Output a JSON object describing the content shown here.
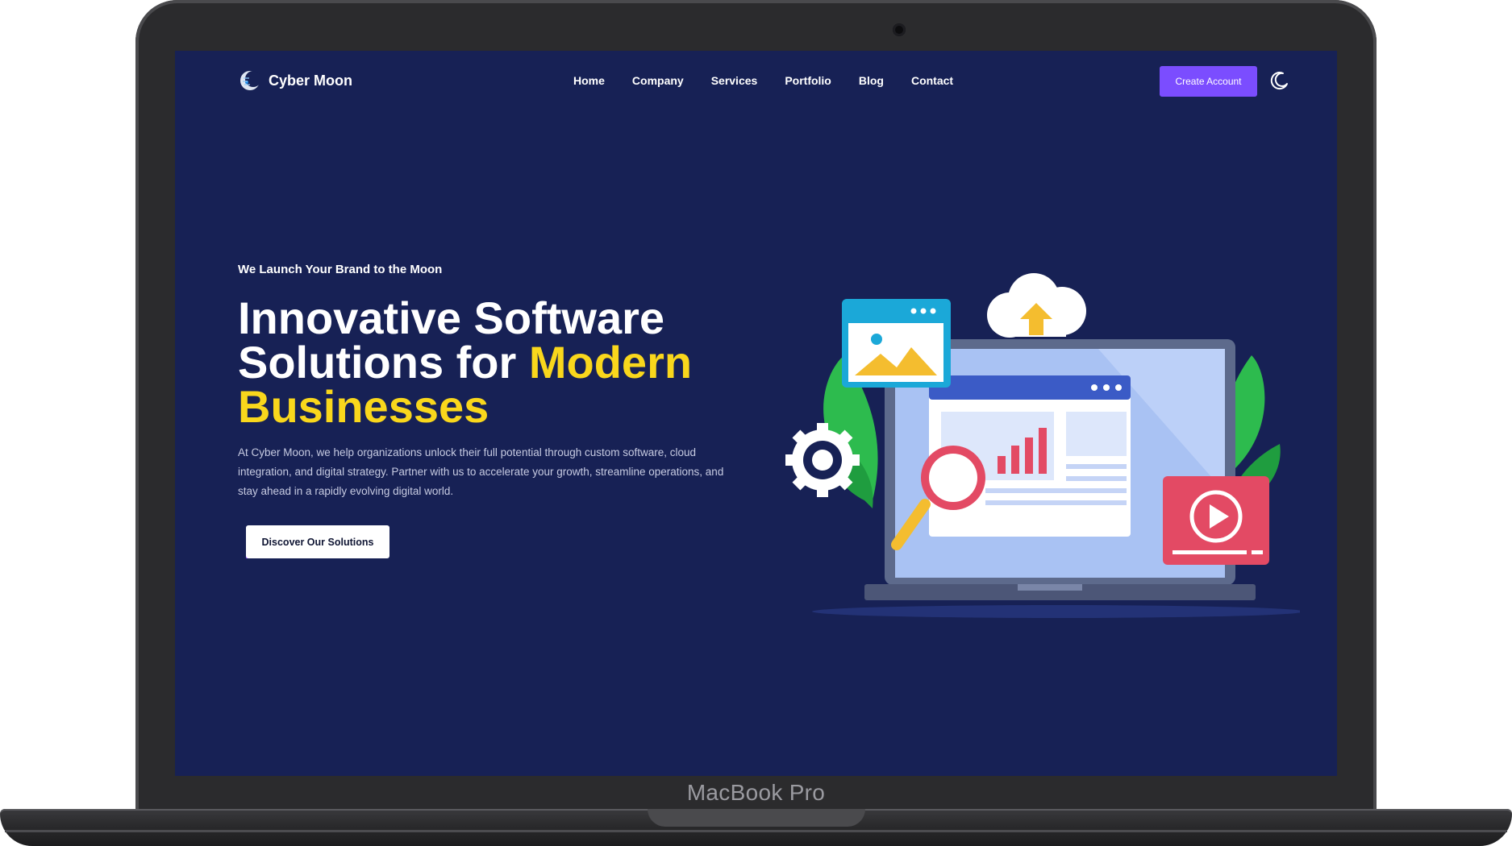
{
  "device": {
    "label": "MacBook Pro"
  },
  "brand": {
    "name": "Cyber Moon"
  },
  "nav": {
    "links": [
      "Home",
      "Company",
      "Services",
      "Portfolio",
      "Blog",
      "Contact"
    ],
    "cta_label": "Create Account"
  },
  "hero": {
    "eyebrow": "We Launch Your Brand to the Moon",
    "headline_part1": "Innovative Software Solutions for",
    "headline_highlight": "Modern Businesses",
    "description": "At Cyber Moon, we help organizations unlock their full potential through custom software, cloud integration, and digital strategy. Partner with us to accelerate your growth, streamline operations, and stay ahead in a rapidly evolving digital world.",
    "button_label": "Discover Our Solutions"
  },
  "colors": {
    "background": "#172155",
    "accent": "#7b4dff",
    "highlight": "#f9d71c"
  },
  "icons": [
    "moon-logo-icon",
    "moon-theme-toggle-icon"
  ]
}
